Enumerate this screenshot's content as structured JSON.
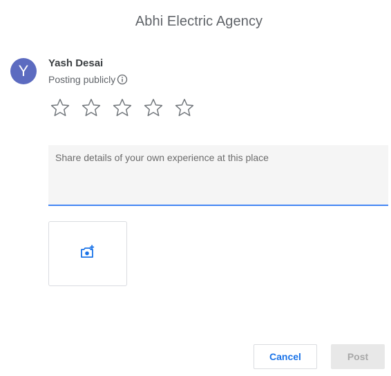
{
  "dialog": {
    "title": "Abhi Electric Agency"
  },
  "user": {
    "initial": "Y",
    "name": "Yash Desai",
    "posting_label": "Posting publicly"
  },
  "rating": {
    "stars": 5,
    "selected": 0
  },
  "review": {
    "placeholder": "Share details of your own experience at this place",
    "value": ""
  },
  "actions": {
    "cancel_label": "Cancel",
    "post_label": "Post"
  },
  "colors": {
    "accent": "#1a73e8",
    "avatar": "#5c6bc0",
    "underline": "#4285f4"
  },
  "icons": {
    "info": "info-icon",
    "star": "star-outline-icon",
    "photo": "add-photo-icon"
  }
}
